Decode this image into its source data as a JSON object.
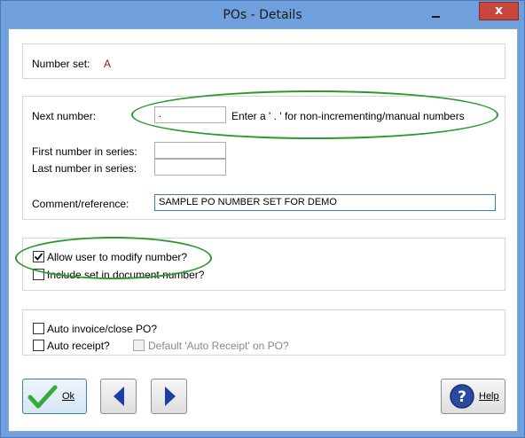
{
  "window": {
    "title": "POs - Details",
    "close_label": "x"
  },
  "number_set": {
    "label": "Number set:",
    "value": "A"
  },
  "next_number": {
    "label": "Next number:",
    "value": ".",
    "hint": "Enter a ' . ' for non-incrementing/manual numbers"
  },
  "first_number": {
    "label": "First number in series:",
    "value": ""
  },
  "last_number": {
    "label": "Last number in series:",
    "value": ""
  },
  "comment": {
    "label": "Comment/reference:",
    "value": "SAMPLE PO NUMBER SET FOR DEMO"
  },
  "options": {
    "allow_modify": {
      "label": "Allow user to modify number?",
      "checked": true
    },
    "include_set": {
      "label": "Include set in document number?",
      "checked": false
    }
  },
  "auto": {
    "invoice_close": {
      "label": "Auto invoice/close PO?",
      "checked": false
    },
    "receipt": {
      "label": "Auto receipt?",
      "checked": false
    },
    "default_receipt": {
      "label": "Default 'Auto Receipt' on PO?",
      "checked": false,
      "disabled": true
    }
  },
  "buttons": {
    "ok_label": "Ok",
    "help_label": "Help"
  },
  "colors": {
    "accent": "#2a9a2a",
    "ok_check": "#3aa83a",
    "nav_arrow": "#1b3fa8"
  }
}
